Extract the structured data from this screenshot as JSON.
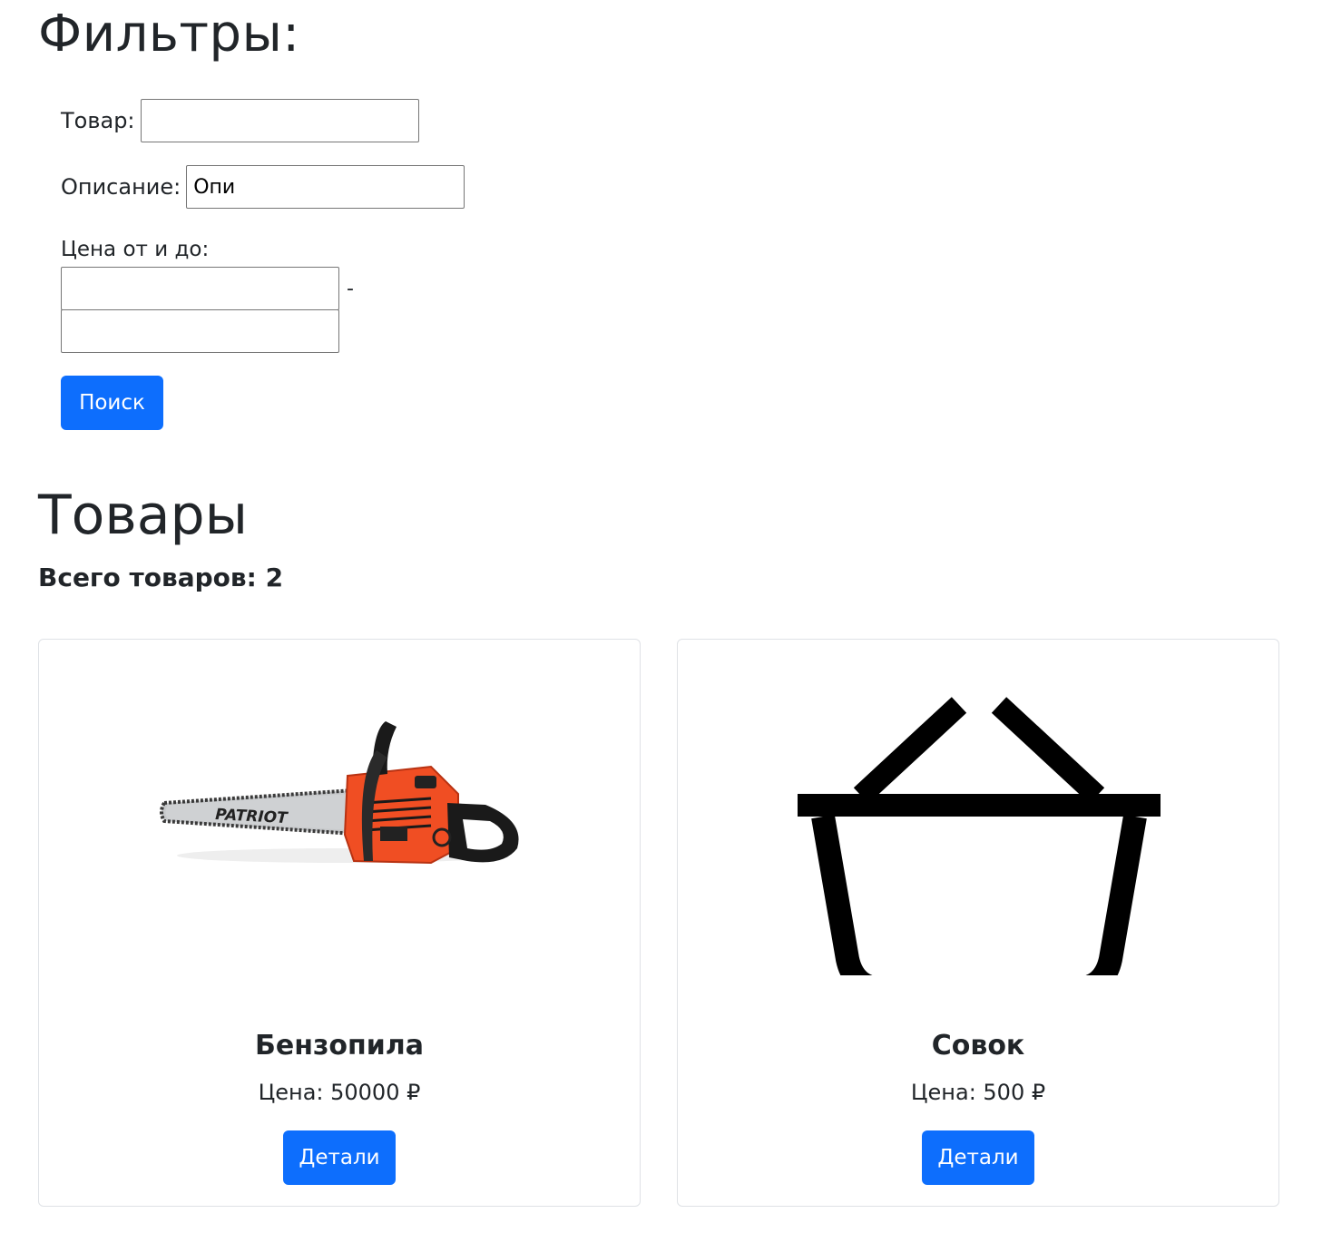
{
  "filters": {
    "title": "Фильтры:",
    "product_label": "Товар:",
    "product_value": "",
    "description_label": "Описание:",
    "description_value": "Опи",
    "price_label": "Цена от и до:",
    "price_from_value": "",
    "price_separator": "-",
    "price_to_value": "",
    "search_button": "Поиск"
  },
  "products": {
    "title": "Товары",
    "total": "Всего товаров: 2",
    "items": [
      {
        "name": "Бензопила",
        "price": "Цена: 50000 ₽",
        "details_button": "Детали",
        "image": "chainsaw-image",
        "image_brand_text": "PATRIOT"
      },
      {
        "name": "Совок",
        "price": "Цена: 500 ₽",
        "details_button": "Детали",
        "image": "basket-icon"
      }
    ]
  },
  "colors": {
    "primary": "#0d6efd",
    "chainsaw_body": "#f04e23",
    "text": "#212529"
  }
}
